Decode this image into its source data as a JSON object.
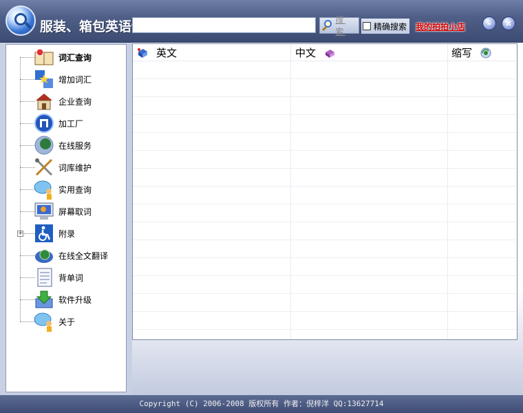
{
  "header": {
    "title": "服装、箱包英语词汇通",
    "search_value": "",
    "search_button": "搜 索",
    "exact_search_label": "精确搜索",
    "shop_link": "我的拍拍小店"
  },
  "window_controls": {
    "minimize_icon": "minimize-circle-icon",
    "close_icon": "close-circle-icon"
  },
  "sidebar": {
    "items": [
      {
        "label": "词汇查询",
        "icon": "book-search-icon",
        "selected": true
      },
      {
        "label": "增加词汇",
        "icon": "add-word-icon"
      },
      {
        "label": "企业查询",
        "icon": "house-icon"
      },
      {
        "label": "加工厂",
        "icon": "factory-icon"
      },
      {
        "label": "在线服务",
        "icon": "globe-icon"
      },
      {
        "label": "词库维护",
        "icon": "tools-icon"
      },
      {
        "label": "实用查询",
        "icon": "chat-person-icon"
      },
      {
        "label": "屏幕取词",
        "icon": "monitor-icon"
      },
      {
        "label": "附录",
        "icon": "accessibility-icon",
        "expandable": true
      },
      {
        "label": "在线全文翻译",
        "icon": "globe-disc-icon"
      },
      {
        "label": "背单词",
        "icon": "document-icon"
      },
      {
        "label": "软件升级",
        "icon": "download-icon"
      },
      {
        "label": "关于",
        "icon": "chat-person-icon"
      }
    ]
  },
  "table": {
    "columns": [
      {
        "label": "英文",
        "icon": "blue-book-icon"
      },
      {
        "label": "中文",
        "icon": "purple-book-icon"
      },
      {
        "label": "缩写",
        "icon": "refresh-disc-icon"
      }
    ],
    "rows": []
  },
  "footer": {
    "copyright": "Copyright (C) 2006-2008 版权所有 作者：倪梓洋  QQ:13627714"
  }
}
